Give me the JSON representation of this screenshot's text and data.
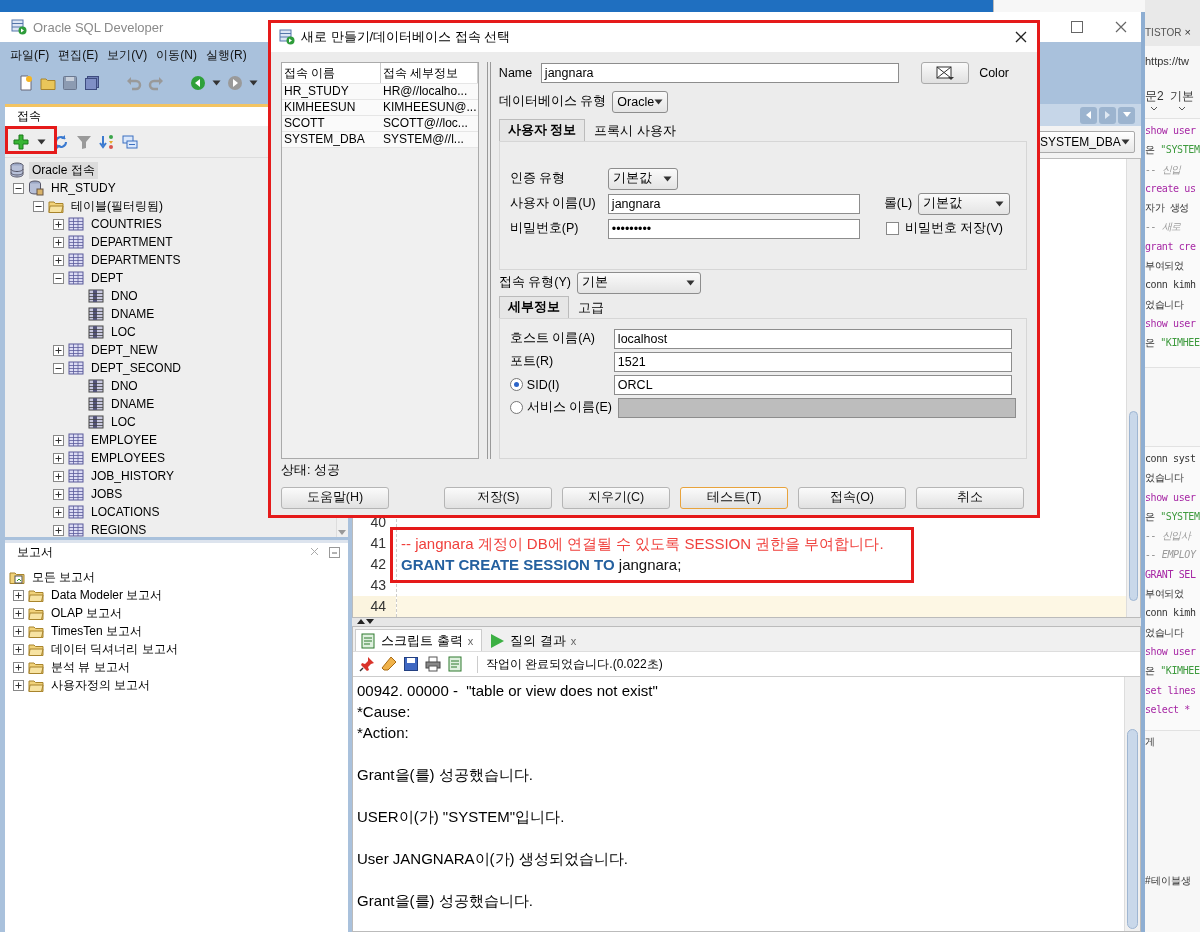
{
  "browser_window": {
    "tab": "TISTOR",
    "tab_close": "×",
    "address": "https://tw",
    "toolbar": [
      "문2",
      "기본"
    ],
    "code_blocks": [
      [
        [
          {
            "text": "show user",
            "kind": "keyword"
          }
        ],
        [
          {
            "text": "은 ",
            "kind": "plain"
          },
          {
            "text": "\"SYSTEM",
            "kind": "string"
          }
        ],
        [
          {
            "text": "-- 신입 ",
            "kind": "comment"
          }
        ],
        [
          {
            "text": "create us",
            "kind": "keyword"
          }
        ],
        [
          {
            "text": "자가 생성",
            "kind": "plain"
          }
        ],
        [
          {
            "text": "-- 새로 ",
            "kind": "comment"
          }
        ],
        [
          {
            "text": "grant cre",
            "kind": "keyword"
          }
        ],
        [
          {
            "text": "부여되었",
            "kind": "plain"
          }
        ],
        [
          {
            "text": "conn kimh",
            "kind": "plain"
          }
        ],
        [
          {
            "text": "었습니다",
            "kind": "plain"
          }
        ],
        [
          {
            "text": "show user",
            "kind": "keyword"
          }
        ],
        [
          {
            "text": "은 ",
            "kind": "plain"
          },
          {
            "text": "\"KIMHEE",
            "kind": "string"
          }
        ]
      ],
      [
        [
          {
            "text": "conn syst",
            "kind": "plain"
          }
        ],
        [
          {
            "text": "었습니다",
            "kind": "plain"
          }
        ],
        [
          {
            "text": "show user",
            "kind": "keyword"
          }
        ],
        [
          {
            "text": "은 ",
            "kind": "plain"
          },
          {
            "text": "\"SYSTEM",
            "kind": "string"
          }
        ],
        [
          {
            "text": "-- 신입사",
            "kind": "comment"
          }
        ],
        [
          {
            "text": "-- EMPLOY",
            "kind": "comment"
          }
        ],
        [
          {
            "text": "GRANT SEL",
            "kind": "keyword"
          }
        ],
        [
          {
            "text": "부여되었",
            "kind": "plain"
          }
        ],
        [
          {
            "text": "conn kimh",
            "kind": "plain"
          }
        ],
        [
          {
            "text": "었습니다",
            "kind": "plain"
          }
        ],
        [
          {
            "text": "show user",
            "kind": "keyword"
          }
        ],
        [
          {
            "text": "은 ",
            "kind": "plain"
          },
          {
            "text": "\"KIMHEE",
            "kind": "string"
          }
        ],
        [
          {
            "text": "set lines",
            "kind": "keyword"
          }
        ],
        [
          {
            "text": "select *",
            "kind": "keyword"
          }
        ]
      ]
    ],
    "text_fragment": "게",
    "tag": "#테이블생"
  },
  "main_window": {
    "title": "Oracle SQL Developer",
    "menu": [
      "파일(F)",
      "편집(E)",
      "보기(V)",
      "이동(N)",
      "실행(R)"
    ]
  },
  "connections_panel": {
    "title": "접속",
    "tree": [
      {
        "label": "Oracle 접속",
        "kind": "root",
        "children": [
          {
            "label": "HR_STUDY",
            "kind": "connection",
            "expanded": true,
            "children": [
              {
                "label": "테이블(필터링됨)",
                "kind": "folder",
                "expanded": true,
                "children": [
                  {
                    "label": "COUNTRIES",
                    "kind": "table",
                    "expanded": false
                  },
                  {
                    "label": "DEPARTMENT",
                    "kind": "table",
                    "expanded": false
                  },
                  {
                    "label": "DEPARTMENTS",
                    "kind": "table",
                    "expanded": false
                  },
                  {
                    "label": "DEPT",
                    "kind": "table",
                    "expanded": true,
                    "children": [
                      {
                        "label": "DNO",
                        "kind": "column"
                      },
                      {
                        "label": "DNAME",
                        "kind": "column"
                      },
                      {
                        "label": "LOC",
                        "kind": "column"
                      }
                    ]
                  },
                  {
                    "label": "DEPT_NEW",
                    "kind": "table",
                    "expanded": false
                  },
                  {
                    "label": "DEPT_SECOND",
                    "kind": "table",
                    "expanded": true,
                    "children": [
                      {
                        "label": "DNO",
                        "kind": "column"
                      },
                      {
                        "label": "DNAME",
                        "kind": "column"
                      },
                      {
                        "label": "LOC",
                        "kind": "column"
                      }
                    ]
                  },
                  {
                    "label": "EMPLOYEE",
                    "kind": "table",
                    "expanded": false
                  },
                  {
                    "label": "EMPLOYEES",
                    "kind": "table",
                    "expanded": false
                  },
                  {
                    "label": "JOB_HISTORY",
                    "kind": "table",
                    "expanded": false
                  },
                  {
                    "label": "JOBS",
                    "kind": "table",
                    "expanded": false
                  },
                  {
                    "label": "LOCATIONS",
                    "kind": "table",
                    "expanded": false
                  },
                  {
                    "label": "REGIONS",
                    "kind": "table",
                    "expanded": false
                  }
                ]
              }
            ]
          }
        ]
      }
    ]
  },
  "reports_panel": {
    "title": "보고서",
    "items": [
      {
        "label": "모든 보고서",
        "kind": "all"
      },
      {
        "label": "Data Modeler 보고서",
        "kind": "folder",
        "expanded": false
      },
      {
        "label": "OLAP 보고서",
        "kind": "folder",
        "expanded": false
      },
      {
        "label": "TimesTen 보고서",
        "kind": "folder",
        "expanded": false
      },
      {
        "label": "데이터 딕셔너리 보고서",
        "kind": "folder",
        "expanded": false
      },
      {
        "label": "분석 뷰 보고서",
        "kind": "folder",
        "expanded": false
      },
      {
        "label": "사용자정의 보고서",
        "kind": "folder",
        "expanded": false
      }
    ]
  },
  "editor": {
    "connection": "SYSTEM_DBA",
    "lines": [
      {
        "number": "40",
        "current": false
      },
      {
        "number": "41",
        "current": false,
        "segments": [
          {
            "text": "-- jangnara 계정이 DB에 연결될 수 있도록 SESSION 권한을 부여합니다.",
            "kind": "comment"
          }
        ]
      },
      {
        "number": "42",
        "current": false,
        "segments": [
          {
            "text": "GRANT CREATE SESSION TO",
            "kind": "keyword"
          },
          {
            "text": " jangnara;",
            "kind": "plain"
          }
        ]
      },
      {
        "number": "43",
        "current": false
      },
      {
        "number": "44",
        "current": true
      }
    ]
  },
  "output_panel": {
    "tabs": [
      {
        "label": "스크립트 출력",
        "selected": true,
        "close": "x"
      },
      {
        "label": "질의 결과",
        "selected": false,
        "close": "x"
      }
    ],
    "status": "작업이 완료되었습니다.(0.022초)",
    "blocks": [
      [
        "00942. 00000 -  \"table or view does not exist\"",
        "*Cause:",
        "*Action:"
      ],
      [
        "Grant을(를) 성공했습니다."
      ],
      [
        "USER이(가) \"SYSTEM\"입니다."
      ],
      [
        "User JANGNARA이(가) 생성되었습니다."
      ],
      [
        "Grant을(를) 성공했습니다."
      ]
    ]
  },
  "dialog": {
    "title": "새로 만들기/데이터베이스 접속 선택",
    "connections": {
      "columns": [
        "접속 이름",
        "접속 세부정보"
      ],
      "rows": [
        [
          "HR_STUDY",
          "HR@//localho..."
        ],
        [
          "KIMHEESUN",
          "KIMHEESUN@..."
        ],
        [
          "SCOTT",
          "SCOTT@//loc..."
        ],
        [
          "SYSTEM_DBA",
          "SYSTEM@//l..."
        ]
      ]
    },
    "name_label": "Name",
    "name": "jangnara",
    "color_label": "Color",
    "db_type_label": "데이터베이스 유형",
    "db_type": "Oracle",
    "tabs": [
      {
        "label": "사용자 정보",
        "selected": true
      },
      {
        "label": "프록시 사용자",
        "selected": false
      }
    ],
    "auth_type_label": "인증 유형",
    "auth_type": "기본값",
    "username_label": "사용자 이름(U)",
    "username": "jangnara",
    "role_label": "롤(L)",
    "role": "기본값",
    "password_label": "비밀번호(P)",
    "password": "•••••••••",
    "save_password": {
      "label": "비밀번호 저장(V)",
      "checked": false
    },
    "conn_type_label": "접속 유형(Y)",
    "conn_type": "기본",
    "detail_tabs": [
      {
        "label": "세부정보",
        "selected": true
      },
      {
        "label": "고급",
        "selected": false
      }
    ],
    "host_label": "호스트 이름(A)",
    "host": "localhost",
    "port_label": "포트(R)",
    "port": "1521",
    "sid": {
      "label": "SID(I)",
      "selected": true,
      "value": "ORCL"
    },
    "service": {
      "label": "서비스 이름(E)",
      "selected": false,
      "disabled": true
    },
    "status": "상태: 성공",
    "help_button": "도움말(H)",
    "buttons": [
      {
        "label": "저장(S)",
        "focused": false
      },
      {
        "label": "지우기(C)",
        "focused": false
      },
      {
        "label": "테스트(T)",
        "focused": true
      },
      {
        "label": "접속(O)",
        "focused": false
      },
      {
        "label": "취소",
        "focused": false
      }
    ]
  }
}
